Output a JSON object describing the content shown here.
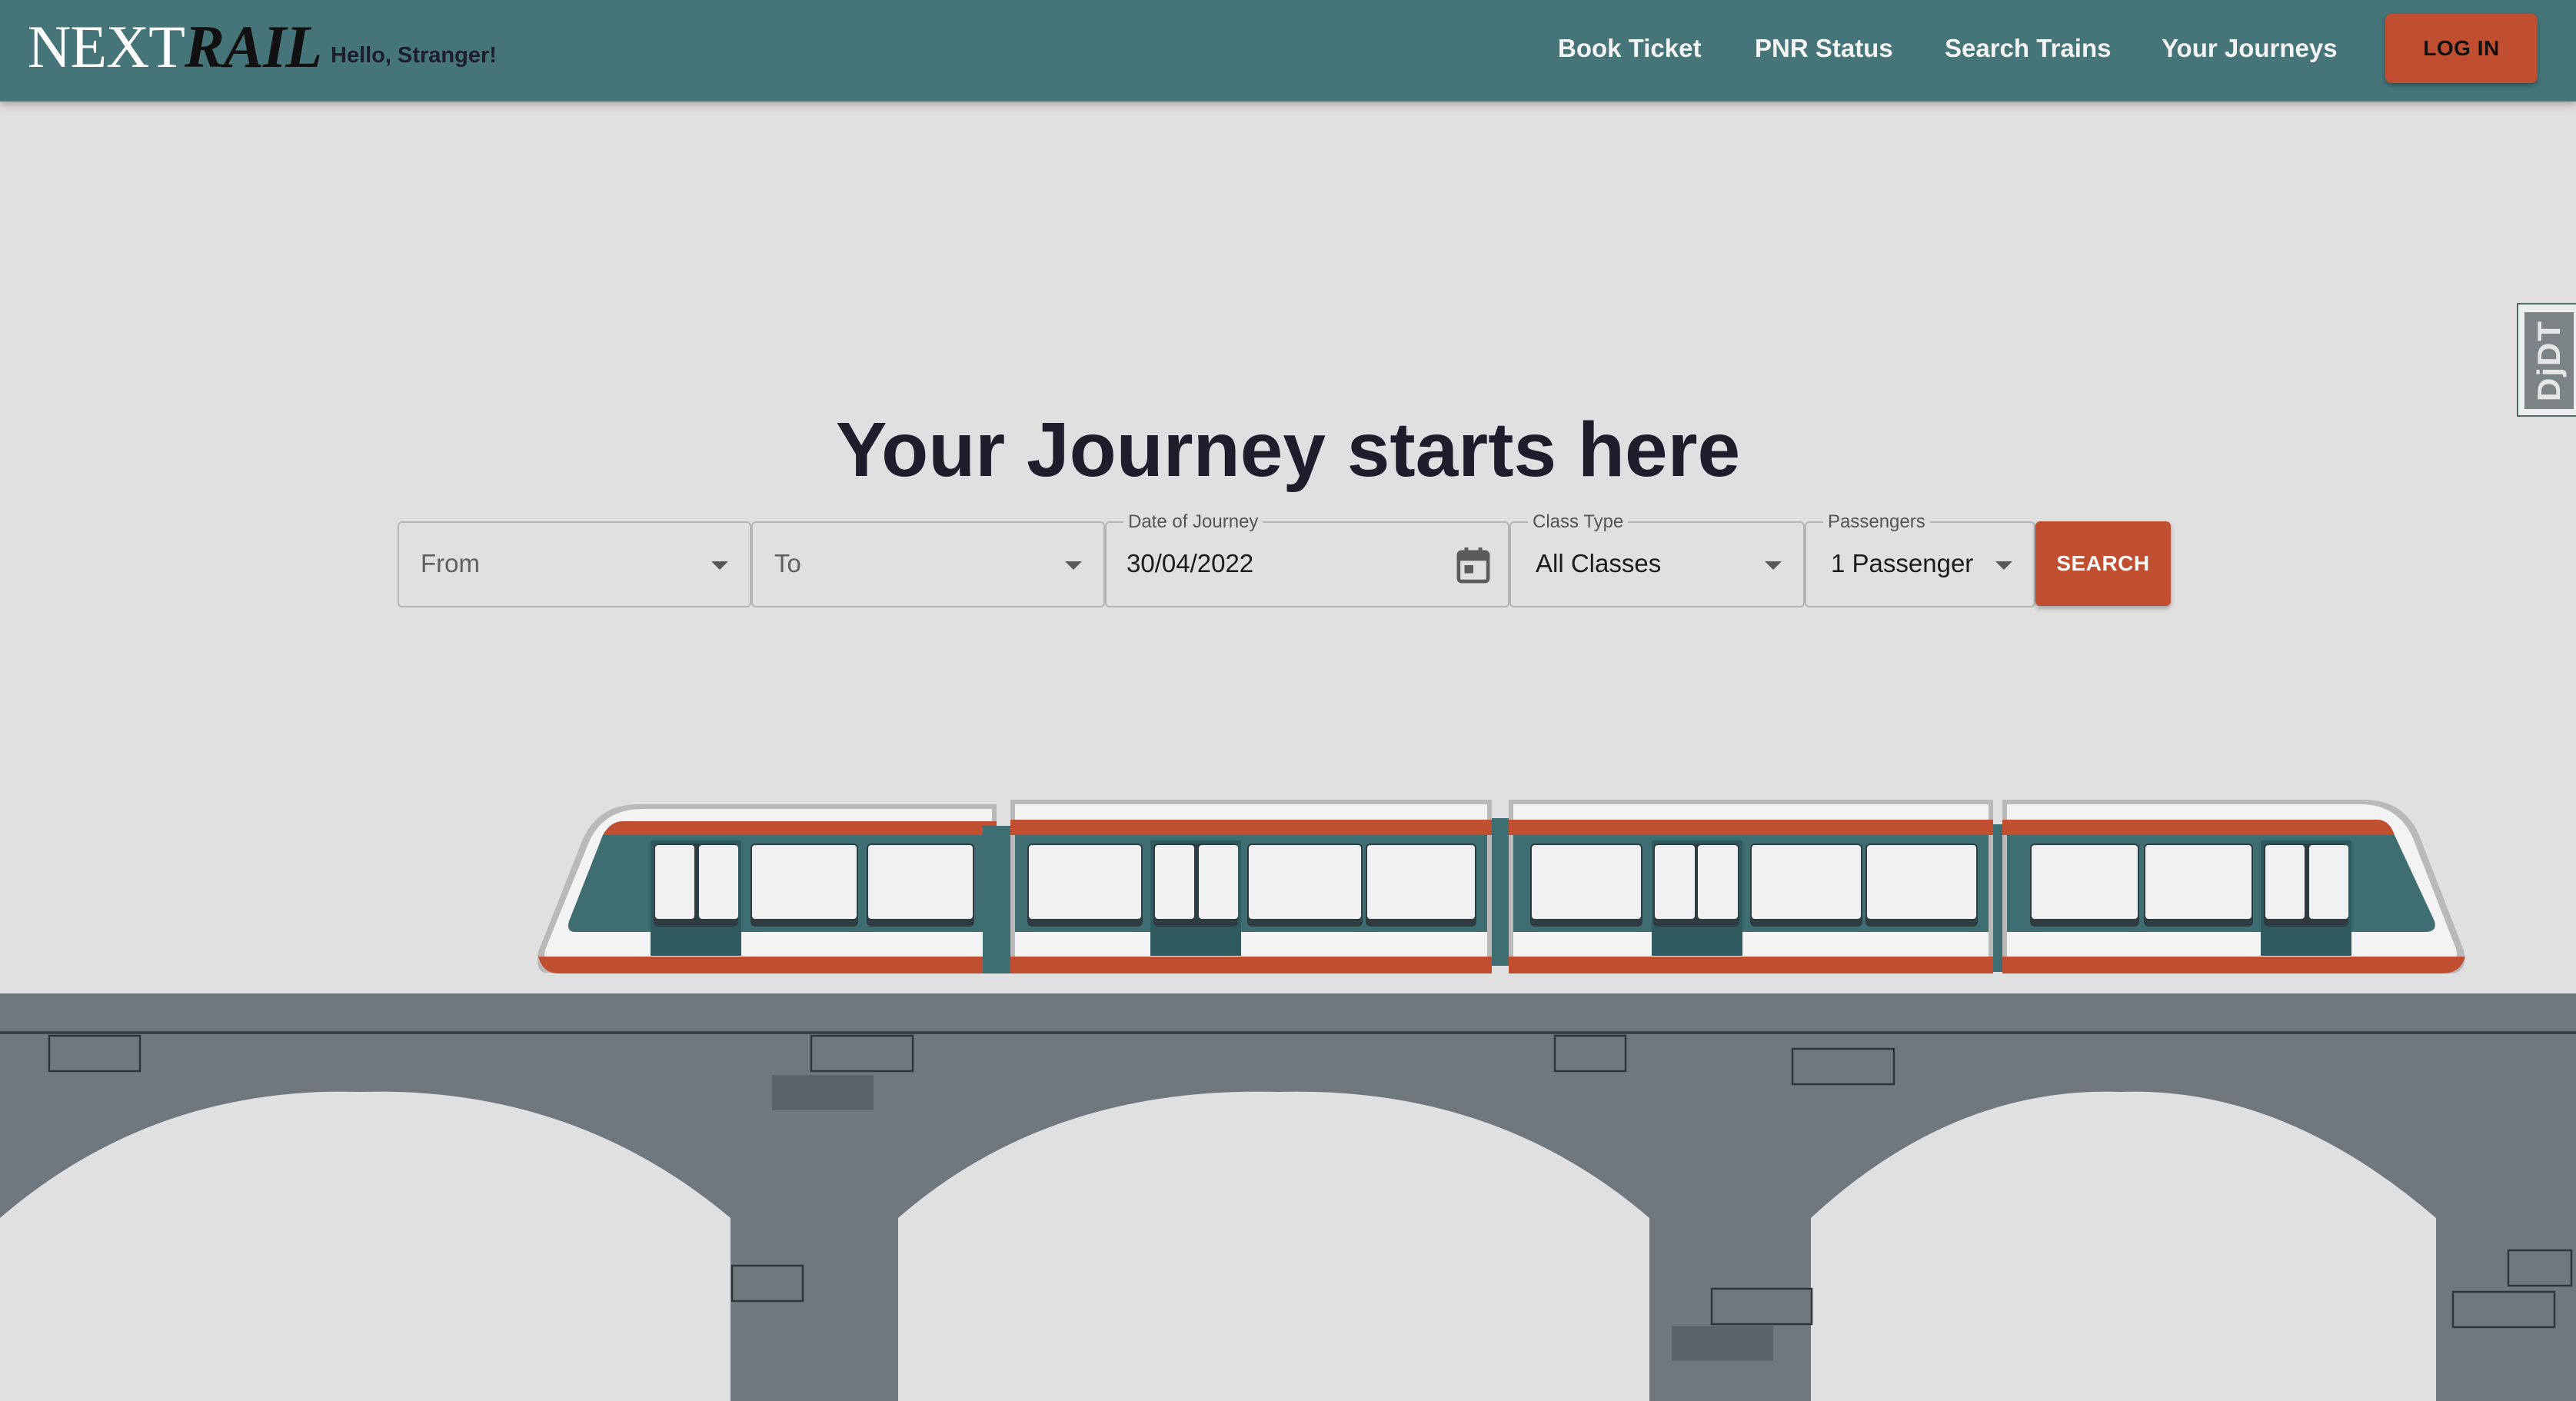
{
  "header": {
    "logo_light": "NEXT",
    "logo_dark": "RAIL",
    "greeting": "Hello, Stranger!",
    "nav": [
      "Book Ticket",
      "PNR Status",
      "Search Trains",
      "Your Journeys"
    ],
    "login_label": "LOG IN"
  },
  "side_tab": {
    "label": "DjDT"
  },
  "hero": {
    "title": "Your Journey starts here"
  },
  "search_form": {
    "from": {
      "placeholder": "From"
    },
    "to": {
      "placeholder": "To"
    },
    "date": {
      "label": "Date of Journey",
      "value": "30/04/2022"
    },
    "class_type": {
      "label": "Class Type",
      "value": "All Classes"
    },
    "passengers": {
      "label": "Passengers",
      "value": "1 Passenger"
    },
    "search_label": "SEARCH"
  },
  "colors": {
    "header_bg": "#457479",
    "accent": "#c04f32",
    "background": "#e0e0e0",
    "bridge": "#6e787e",
    "train_teal": "#3f6e72"
  },
  "icons": {
    "calendar": "calendar-icon",
    "dropdown": "chevron-down-icon"
  }
}
